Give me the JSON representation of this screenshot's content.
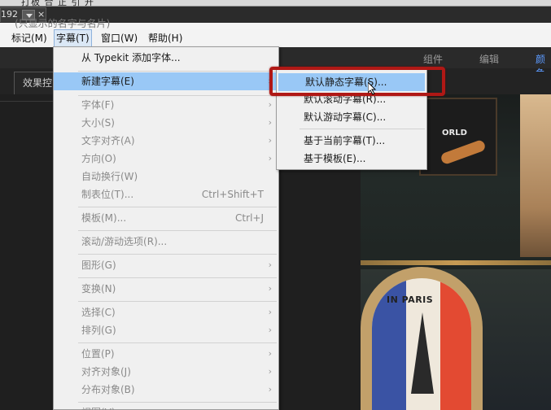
{
  "top_strip": {
    "text": "打板 合 正 引 开"
  },
  "tab": {
    "text": "192",
    "dropdown_icon": "chevron-down-icon",
    "close_glyph": "×"
  },
  "titlebar": {
    "text": "(只显示的名字与名片)"
  },
  "menubar": {
    "items": [
      {
        "label": "标记(M)"
      },
      {
        "label": "字幕(T)"
      },
      {
        "label": "窗口(W)"
      },
      {
        "label": "帮助(H)"
      }
    ]
  },
  "workspaces": {
    "items": [
      {
        "label": "组件"
      },
      {
        "label": "编辑"
      },
      {
        "label": "颜色"
      }
    ],
    "accent_color": "#5c9aff"
  },
  "panel": {
    "tab_label": "效果控"
  },
  "photo": {
    "board_text": "ORLD",
    "chair_text": "IN PARIS"
  },
  "title_menu": {
    "items": [
      {
        "label": "从 Typekit 添加字体...",
        "shortcut": "",
        "submenu": false,
        "enabled": true
      },
      {
        "label": "新建字幕(E)",
        "shortcut": "",
        "submenu": true,
        "enabled": true,
        "highlighted": true
      },
      {
        "label": "字体(F)",
        "shortcut": "",
        "submenu": true,
        "enabled": false
      },
      {
        "label": "大小(S)",
        "shortcut": "",
        "submenu": true,
        "enabled": false
      },
      {
        "label": "文字对齐(A)",
        "shortcut": "",
        "submenu": true,
        "enabled": false
      },
      {
        "label": "方向(O)",
        "shortcut": "",
        "submenu": true,
        "enabled": false
      },
      {
        "label": "自动换行(W)",
        "shortcut": "",
        "submenu": false,
        "enabled": false
      },
      {
        "label": "制表位(T)...",
        "shortcut": "Ctrl+Shift+T",
        "submenu": false,
        "enabled": false
      },
      {
        "label": "模板(M)...",
        "shortcut": "Ctrl+J",
        "submenu": false,
        "enabled": false
      },
      {
        "label": "滚动/游动选项(R)...",
        "shortcut": "",
        "submenu": false,
        "enabled": false
      },
      {
        "label": "图形(G)",
        "shortcut": "",
        "submenu": true,
        "enabled": false
      },
      {
        "label": "变换(N)",
        "shortcut": "",
        "submenu": true,
        "enabled": false
      },
      {
        "label": "选择(C)",
        "shortcut": "",
        "submenu": true,
        "enabled": false
      },
      {
        "label": "排列(G)",
        "shortcut": "",
        "submenu": true,
        "enabled": false
      },
      {
        "label": "位置(P)",
        "shortcut": "",
        "submenu": true,
        "enabled": false
      },
      {
        "label": "对齐对象(J)",
        "shortcut": "",
        "submenu": true,
        "enabled": false
      },
      {
        "label": "分布对象(B)",
        "shortcut": "",
        "submenu": true,
        "enabled": false
      },
      {
        "label": "视图(V)",
        "shortcut": "",
        "submenu": false,
        "enabled": false
      }
    ],
    "submenu_arrow": "›"
  },
  "new_title_submenu": {
    "items": [
      {
        "label": "默认静态字幕(S)...",
        "highlighted": true
      },
      {
        "label": "默认滚动字幕(R)..."
      },
      {
        "label": "默认游动字幕(C)..."
      },
      {
        "label": "基于当前字幕(T)..."
      },
      {
        "label": "基于模板(E)..."
      }
    ],
    "highlight_box_color": "#b01815"
  },
  "colors": {
    "menu_highlight": "#99c8f6",
    "menu_bg": "#f0f0f0"
  }
}
